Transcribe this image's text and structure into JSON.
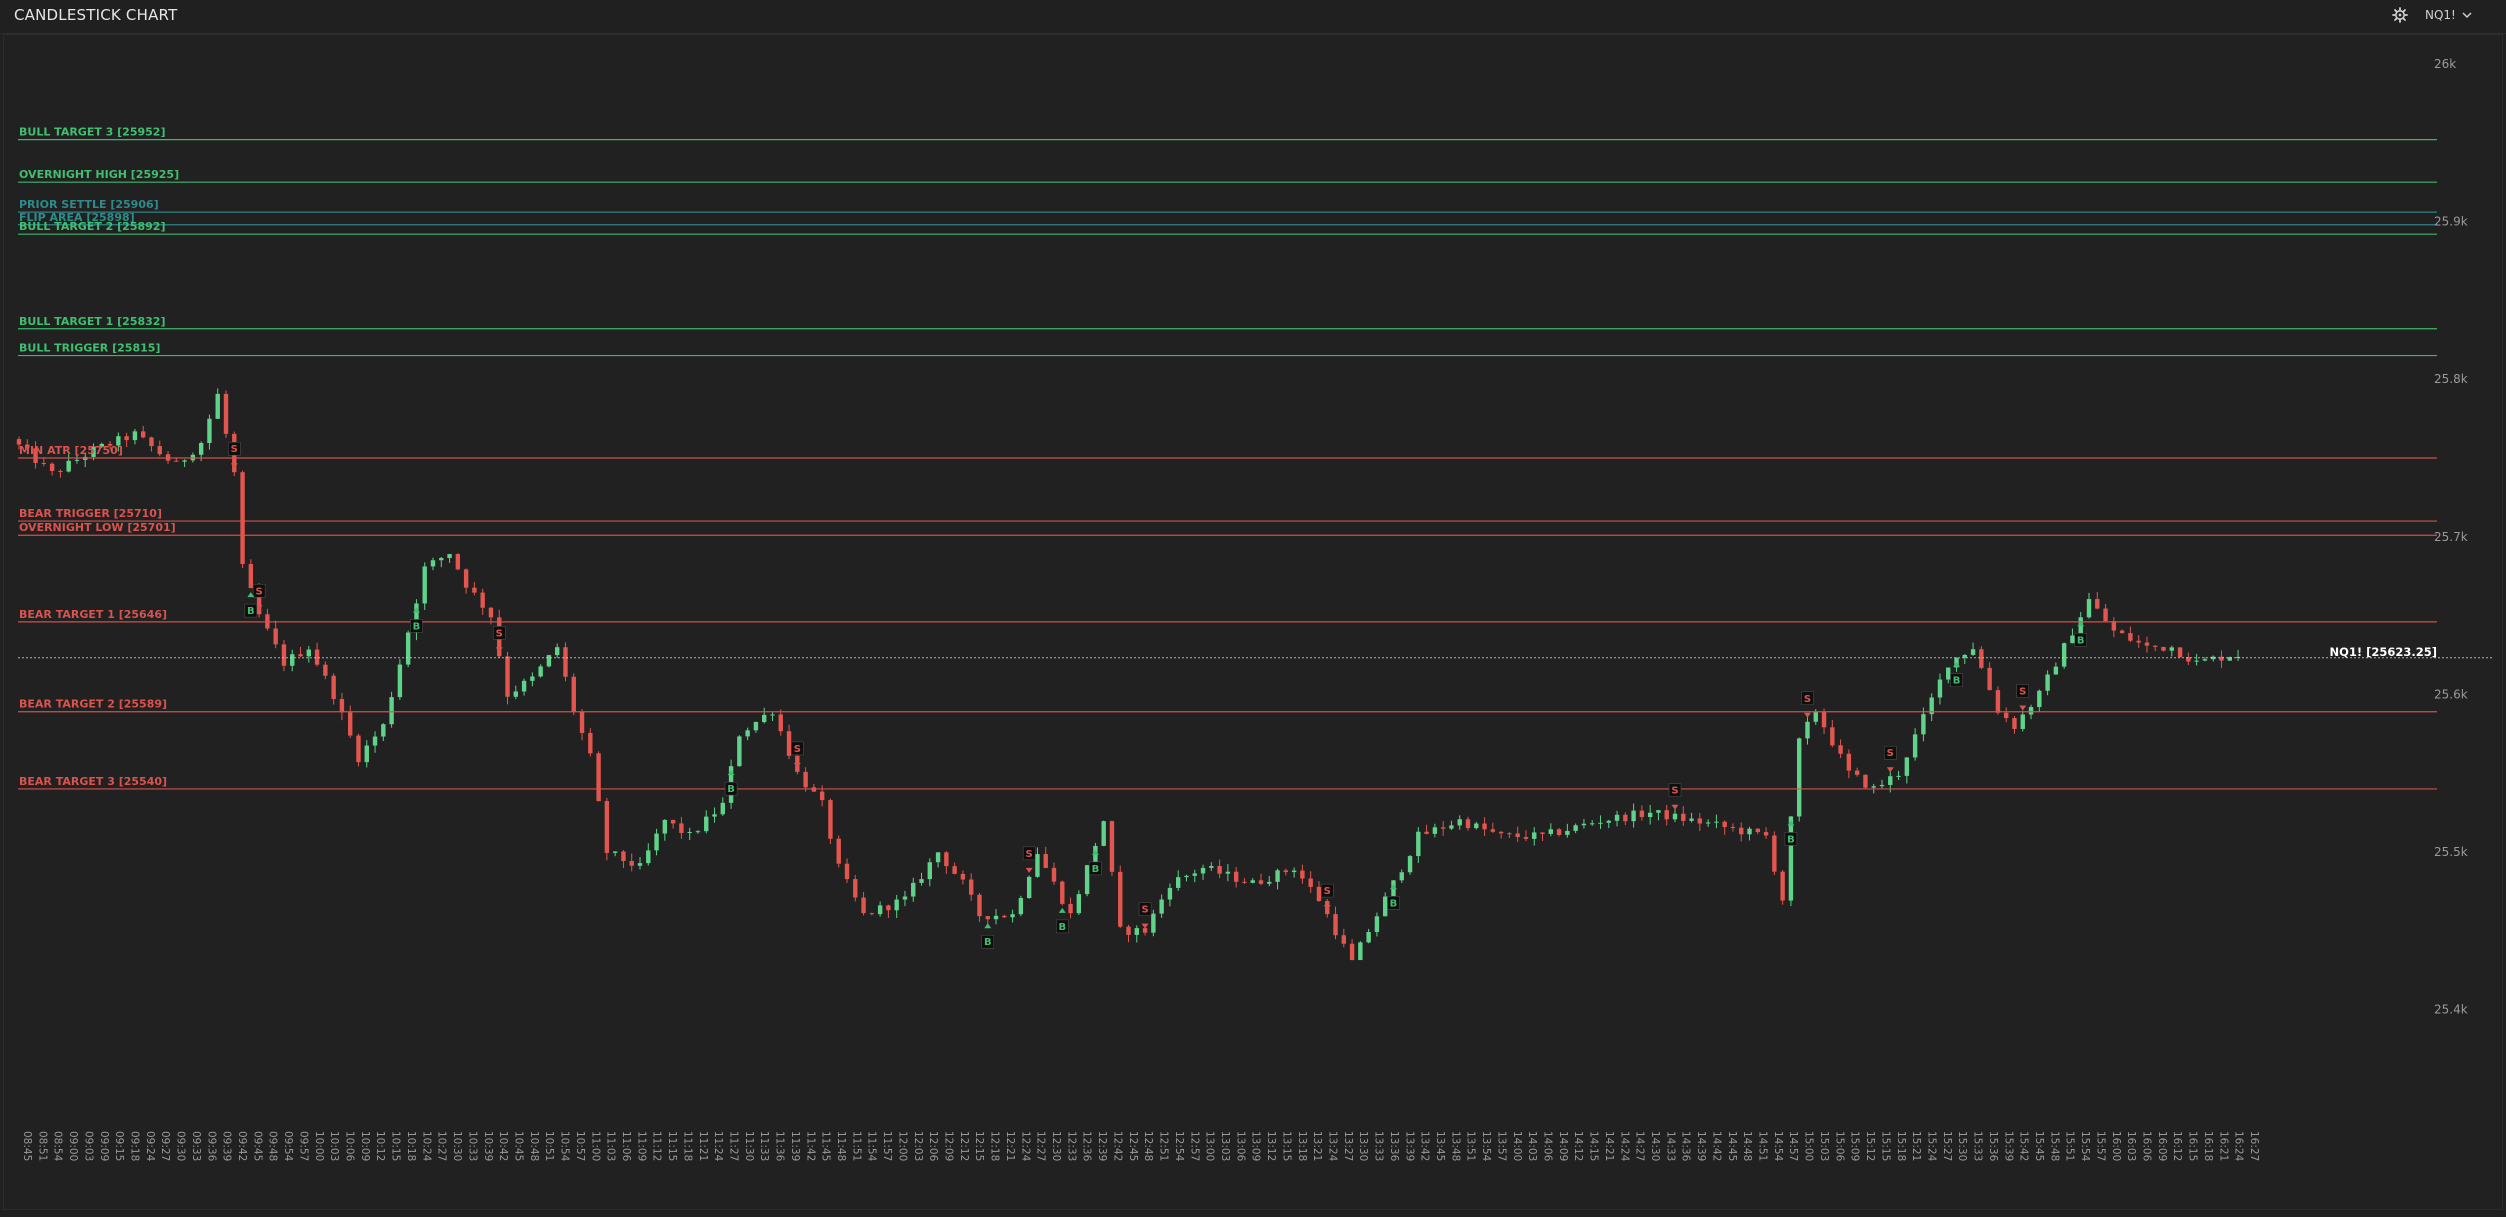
{
  "app": {
    "title": "CANDLESTICK CHART"
  },
  "header": {
    "symbol": "NQ1!",
    "settings_icon": "gear-icon",
    "dropdown_icon": "chevron-down-icon"
  },
  "colors": {
    "bull": "#3fbf6f",
    "bear": "#d9534f",
    "neutral": "#2e8b8b",
    "up_candle": "#5fd38a",
    "down_candle": "#e2564f"
  },
  "chart_data": {
    "type": "candlestick",
    "ylim": [
      25370,
      26020
    ],
    "y_ticks": [
      {
        "value": 26000,
        "label": "26k"
      },
      {
        "value": 25900,
        "label": "25.9k"
      },
      {
        "value": 25800,
        "label": "25.8k"
      },
      {
        "value": 25700,
        "label": "25.7k"
      },
      {
        "value": 25600,
        "label": "25.6k"
      },
      {
        "value": 25500,
        "label": "25.5k"
      },
      {
        "value": 25400,
        "label": "25.4k"
      }
    ],
    "levels": [
      {
        "label": "BULL TARGET 3 [25952]",
        "value": 25952,
        "kind": "bull"
      },
      {
        "label": "OVERNIGHT HIGH [25925]",
        "value": 25925,
        "kind": "bull"
      },
      {
        "label": "PRIOR SETTLE [25906]",
        "value": 25906,
        "kind": "neutral"
      },
      {
        "label": "FLIP AREA [25898]",
        "value": 25898,
        "kind": "neutral"
      },
      {
        "label": "BULL TARGET 2 [25892]",
        "value": 25892,
        "kind": "bull"
      },
      {
        "label": "BULL TARGET 1 [25832]",
        "value": 25832,
        "kind": "bull"
      },
      {
        "label": "BULL TRIGGER [25815]",
        "value": 25815,
        "kind": "bull"
      },
      {
        "label": "MIN ATR [25750]",
        "value": 25750,
        "kind": "bear"
      },
      {
        "label": "BEAR TRIGGER [25710]",
        "value": 25710,
        "kind": "bear"
      },
      {
        "label": "OVERNIGHT LOW [25701]",
        "value": 25701,
        "kind": "bear"
      },
      {
        "label": "BEAR TARGET 1 [25646]",
        "value": 25646,
        "kind": "bear"
      },
      {
        "label": "BEAR TARGET 2 [25589]",
        "value": 25589,
        "kind": "bear"
      },
      {
        "label": "BEAR TARGET 3 [25540]",
        "value": 25540,
        "kind": "bear"
      }
    ],
    "last_price": {
      "label": "NQ1! [25623.25]",
      "value": 25623.25
    },
    "x_labels": [
      "08:45",
      "08:51",
      "08:54",
      "09:00",
      "09:03",
      "09:09",
      "09:15",
      "09:18",
      "09:24",
      "09:27",
      "09:30",
      "09:33",
      "09:36",
      "09:39",
      "09:42",
      "09:45",
      "09:48",
      "09:54",
      "09:57",
      "10:00",
      "10:03",
      "10:06",
      "10:09",
      "10:12",
      "10:15",
      "10:18",
      "10:24",
      "10:27",
      "10:30",
      "10:33",
      "10:39",
      "10:42",
      "10:45",
      "10:48",
      "10:51",
      "10:54",
      "10:57",
      "11:00",
      "11:03",
      "11:06",
      "11:09",
      "11:12",
      "11:15",
      "11:18",
      "11:21",
      "11:24",
      "11:27",
      "11:30",
      "11:33",
      "11:36",
      "11:39",
      "11:42",
      "11:45",
      "11:48",
      "11:51",
      "11:54",
      "11:57",
      "12:00",
      "12:03",
      "12:06",
      "12:09",
      "12:12",
      "12:15",
      "12:18",
      "12:21",
      "12:24",
      "12:27",
      "12:30",
      "12:33",
      "12:36",
      "12:39",
      "12:42",
      "12:45",
      "12:48",
      "12:51",
      "12:54",
      "12:57",
      "13:00",
      "13:03",
      "13:06",
      "13:09",
      "13:12",
      "13:15",
      "13:18",
      "13:21",
      "13:24",
      "13:27",
      "13:30",
      "13:33",
      "13:36",
      "13:39",
      "13:42",
      "13:45",
      "13:48",
      "13:51",
      "13:54",
      "13:57",
      "14:00",
      "14:03",
      "14:06",
      "14:09",
      "14:12",
      "14:15",
      "14:21",
      "14:24",
      "14:27",
      "14:30",
      "14:33",
      "14:36",
      "14:39",
      "14:42",
      "14:45",
      "14:48",
      "14:51",
      "14:54",
      "14:57",
      "15:00",
      "15:03",
      "15:06",
      "15:09",
      "15:12",
      "15:15",
      "15:18",
      "15:21",
      "15:24",
      "15:27",
      "15:30",
      "15:33",
      "15:36",
      "15:39",
      "15:42",
      "15:45",
      "15:48",
      "15:51",
      "15:54",
      "15:57",
      "16:00",
      "16:03",
      "16:06",
      "16:09",
      "16:12",
      "16:15",
      "16:18",
      "16:21",
      "16:24",
      "16:27"
    ],
    "path": [
      [
        0,
        25762
      ],
      [
        5,
        25740
      ],
      [
        10,
        25755
      ],
      [
        15,
        25765
      ],
      [
        20,
        25745
      ],
      [
        23,
        25760
      ],
      [
        25,
        25790
      ],
      [
        27,
        25740
      ],
      [
        28,
        25680
      ],
      [
        30,
        25650
      ],
      [
        33,
        25620
      ],
      [
        36,
        25630
      ],
      [
        39,
        25600
      ],
      [
        42,
        25560
      ],
      [
        45,
        25580
      ],
      [
        47,
        25620
      ],
      [
        50,
        25680
      ],
      [
        53,
        25690
      ],
      [
        55,
        25670
      ],
      [
        58,
        25650
      ],
      [
        60,
        25600
      ],
      [
        63,
        25610
      ],
      [
        66,
        25630
      ],
      [
        68,
        25590
      ],
      [
        70,
        25560
      ],
      [
        72,
        25500
      ],
      [
        76,
        25490
      ],
      [
        79,
        25520
      ],
      [
        82,
        25510
      ],
      [
        86,
        25530
      ],
      [
        88,
        25575
      ],
      [
        92,
        25590
      ],
      [
        95,
        25550
      ],
      [
        98,
        25530
      ],
      [
        100,
        25490
      ],
      [
        103,
        25460
      ],
      [
        108,
        25470
      ],
      [
        112,
        25500
      ],
      [
        115,
        25480
      ],
      [
        117,
        25460
      ],
      [
        121,
        25460
      ],
      [
        124,
        25500
      ],
      [
        128,
        25460
      ],
      [
        132,
        25520
      ],
      [
        134,
        25450
      ],
      [
        137,
        25450
      ],
      [
        140,
        25480
      ],
      [
        144,
        25490
      ],
      [
        150,
        25480
      ],
      [
        155,
        25490
      ],
      [
        158,
        25470
      ],
      [
        160,
        25450
      ],
      [
        162,
        25430
      ],
      [
        166,
        25470
      ],
      [
        170,
        25510
      ],
      [
        175,
        25520
      ],
      [
        180,
        25510
      ],
      [
        185,
        25510
      ],
      [
        192,
        25520
      ],
      [
        198,
        25525
      ],
      [
        205,
        25518
      ],
      [
        212,
        25510
      ],
      [
        214,
        25470
      ],
      [
        216,
        25570
      ],
      [
        218,
        25590
      ],
      [
        220,
        25570
      ],
      [
        222,
        25550
      ],
      [
        225,
        25540
      ],
      [
        228,
        25550
      ],
      [
        231,
        25585
      ],
      [
        234,
        25620
      ],
      [
        237,
        25630
      ],
      [
        240,
        25590
      ],
      [
        242,
        25580
      ],
      [
        245,
        25600
      ],
      [
        248,
        25630
      ],
      [
        251,
        25660
      ],
      [
        254,
        25640
      ],
      [
        258,
        25630
      ],
      [
        261,
        25630
      ],
      [
        264,
        25620
      ],
      [
        268,
        25625
      ]
    ],
    "signals": [
      {
        "i": 26,
        "type": "S"
      },
      {
        "i": 29,
        "type": "S"
      },
      {
        "i": 28,
        "type": "B"
      },
      {
        "i": 48,
        "type": "B"
      },
      {
        "i": 58,
        "type": "S"
      },
      {
        "i": 86,
        "type": "B"
      },
      {
        "i": 94,
        "type": "S"
      },
      {
        "i": 117,
        "type": "B"
      },
      {
        "i": 122,
        "type": "S"
      },
      {
        "i": 126,
        "type": "B"
      },
      {
        "i": 130,
        "type": "B"
      },
      {
        "i": 136,
        "type": "S"
      },
      {
        "i": 158,
        "type": "S"
      },
      {
        "i": 166,
        "type": "B"
      },
      {
        "i": 216,
        "type": "S"
      },
      {
        "i": 214,
        "type": "B"
      },
      {
        "i": 226,
        "type": "S"
      },
      {
        "i": 234,
        "type": "B"
      },
      {
        "i": 242,
        "type": "S"
      },
      {
        "i": 249,
        "type": "B"
      },
      {
        "i": 200,
        "type": "S"
      }
    ],
    "bar_count": 269
  }
}
